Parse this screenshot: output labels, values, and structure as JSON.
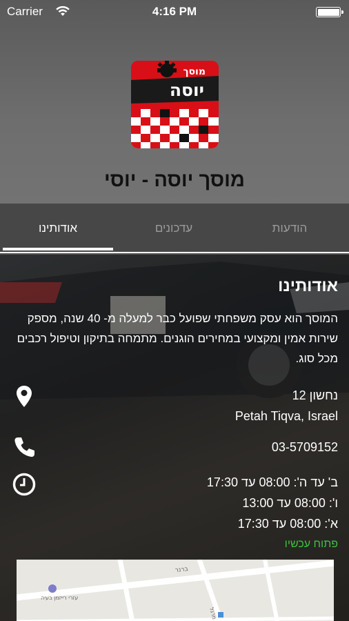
{
  "status_bar": {
    "carrier": "Carrier",
    "time": "4:16 PM",
    "wifi_icon": "wifi-icon",
    "battery_icon": "battery-icon"
  },
  "header": {
    "app_title": "מוסך יוסה - יוסי",
    "logo": {
      "top_text": "מוסך",
      "main_text": "יוסה",
      "colors": {
        "red": "#d80f17",
        "black": "#111111",
        "white": "#ffffff"
      }
    }
  },
  "tabs": [
    {
      "label": "הודעות",
      "active": false
    },
    {
      "label": "עדכונים",
      "active": false
    },
    {
      "label": "אודותינו",
      "active": true
    }
  ],
  "about": {
    "title": "אודותינו",
    "text": "המוסך הוא עסק משפחתי שפועל כבר למעלה מ- 40 שנה, מספק שירות אמין ומקצועי במחירים הוגנים. מתמחה בתיקון וטיפול רכבים מכל סוג."
  },
  "contact": {
    "address_line1": "נחשון 12",
    "address_line2": "Petah Tiqva, Israel",
    "phone": "03-5709152",
    "hours": [
      "ב' עד ה': 08:00 עד 17:30",
      "ו': 08:00 עד 13:00",
      "א': 08:00 עד 17:30"
    ],
    "open_status": "פתוח עכשיו",
    "icons": {
      "address": "location-pin-icon",
      "phone": "phone-icon",
      "hours": "clock-icon"
    }
  },
  "map": {
    "labels": [
      "ברנר",
      "עזרי רייזמן בעיה",
      "מרגל"
    ]
  },
  "colors": {
    "open_green": "#3fc23f",
    "header_gray": "#6a6a6a",
    "tab_underline": "#ffffff"
  }
}
